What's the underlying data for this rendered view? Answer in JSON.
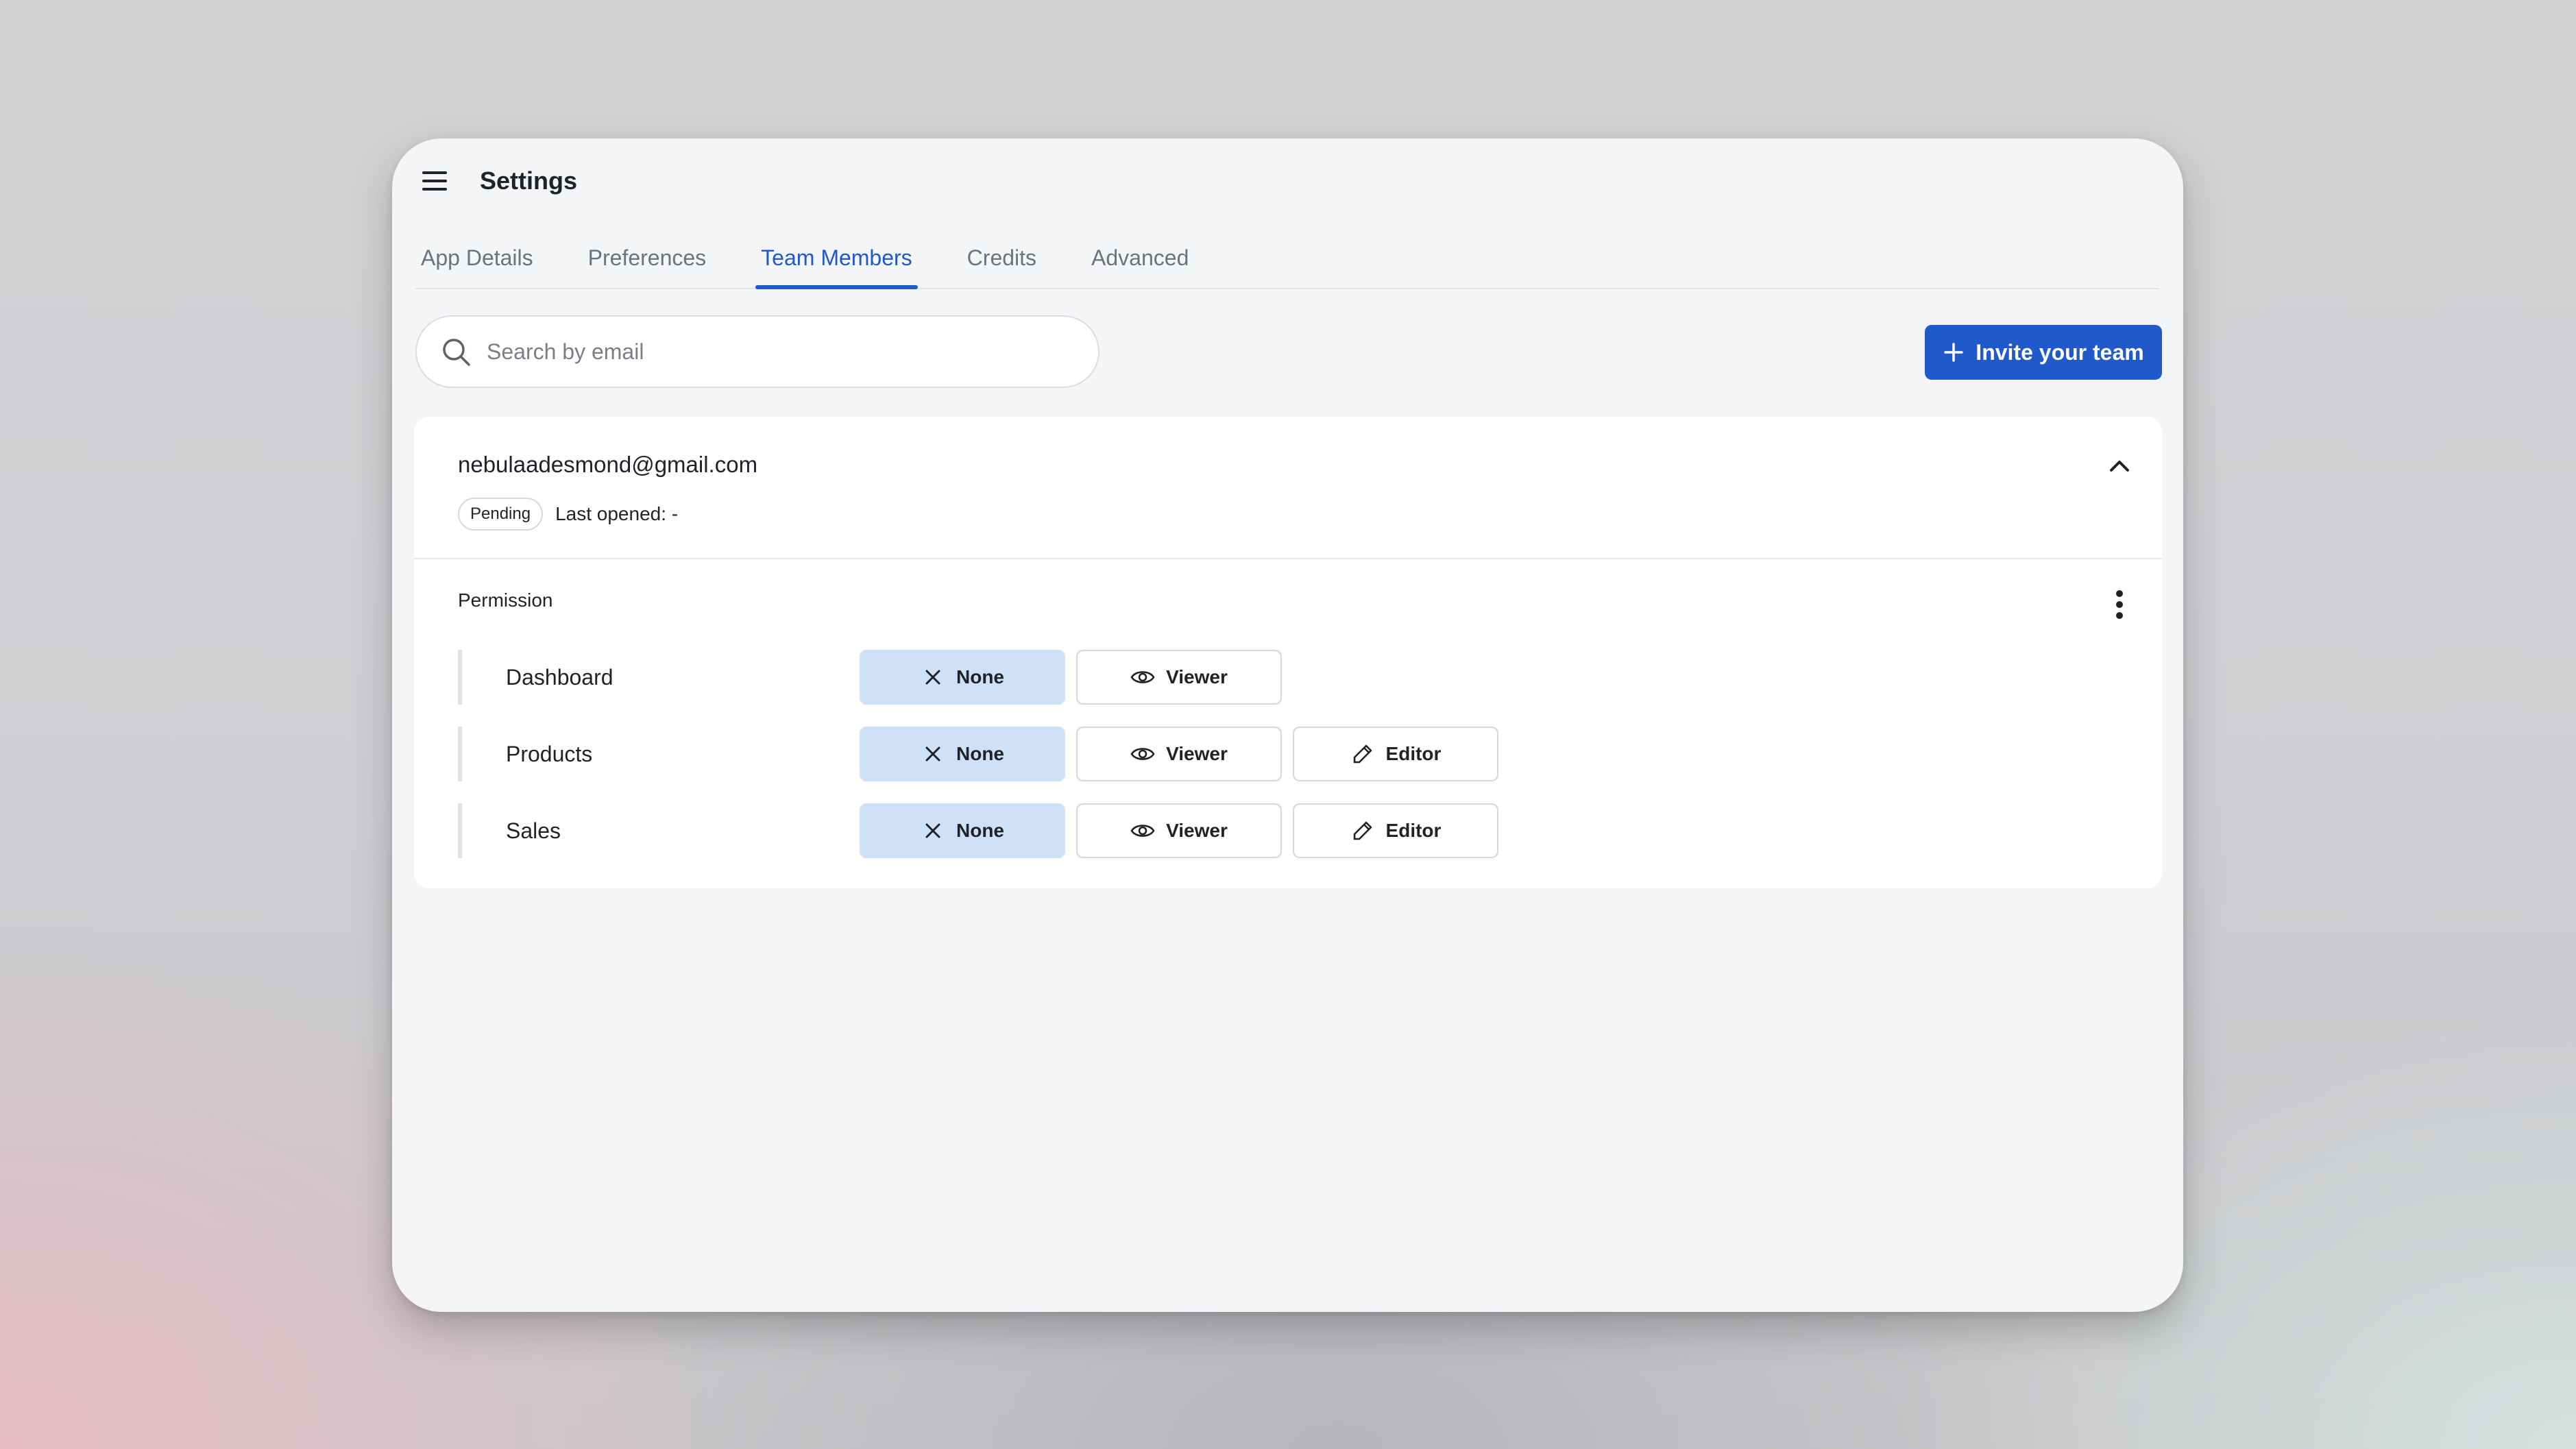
{
  "header": {
    "title": "Settings"
  },
  "tabs": [
    {
      "label": "App Details",
      "active": false
    },
    {
      "label": "Preferences",
      "active": false
    },
    {
      "label": "Team Members",
      "active": true
    },
    {
      "label": "Credits",
      "active": false
    },
    {
      "label": "Advanced",
      "active": false
    }
  ],
  "search": {
    "placeholder": "Search by email",
    "value": ""
  },
  "invite_button": {
    "label": "Invite your team"
  },
  "member": {
    "email": "nebulaadesmond@gmail.com",
    "status": "Pending",
    "last_opened": "Last opened: -",
    "permission_label": "Permission",
    "permissions": [
      {
        "section": "Dashboard",
        "options": [
          "None",
          "Viewer"
        ],
        "selected": "None"
      },
      {
        "section": "Products",
        "options": [
          "None",
          "Viewer",
          "Editor"
        ],
        "selected": "None"
      },
      {
        "section": "Sales",
        "options": [
          "None",
          "Viewer",
          "Editor"
        ],
        "selected": "None"
      }
    ]
  },
  "colors": {
    "accent": "#2059c9",
    "selected_option_bg": "#cfe1f6",
    "window_bg": "#f4f5f7"
  },
  "icons": {
    "menu": "hamburger-icon",
    "search": "search-icon",
    "invite": "plus-icon",
    "collapse": "chevron-up-icon",
    "more": "kebab-icon",
    "none": "close-icon",
    "viewer": "eye-icon",
    "editor": "pencil-icon"
  }
}
